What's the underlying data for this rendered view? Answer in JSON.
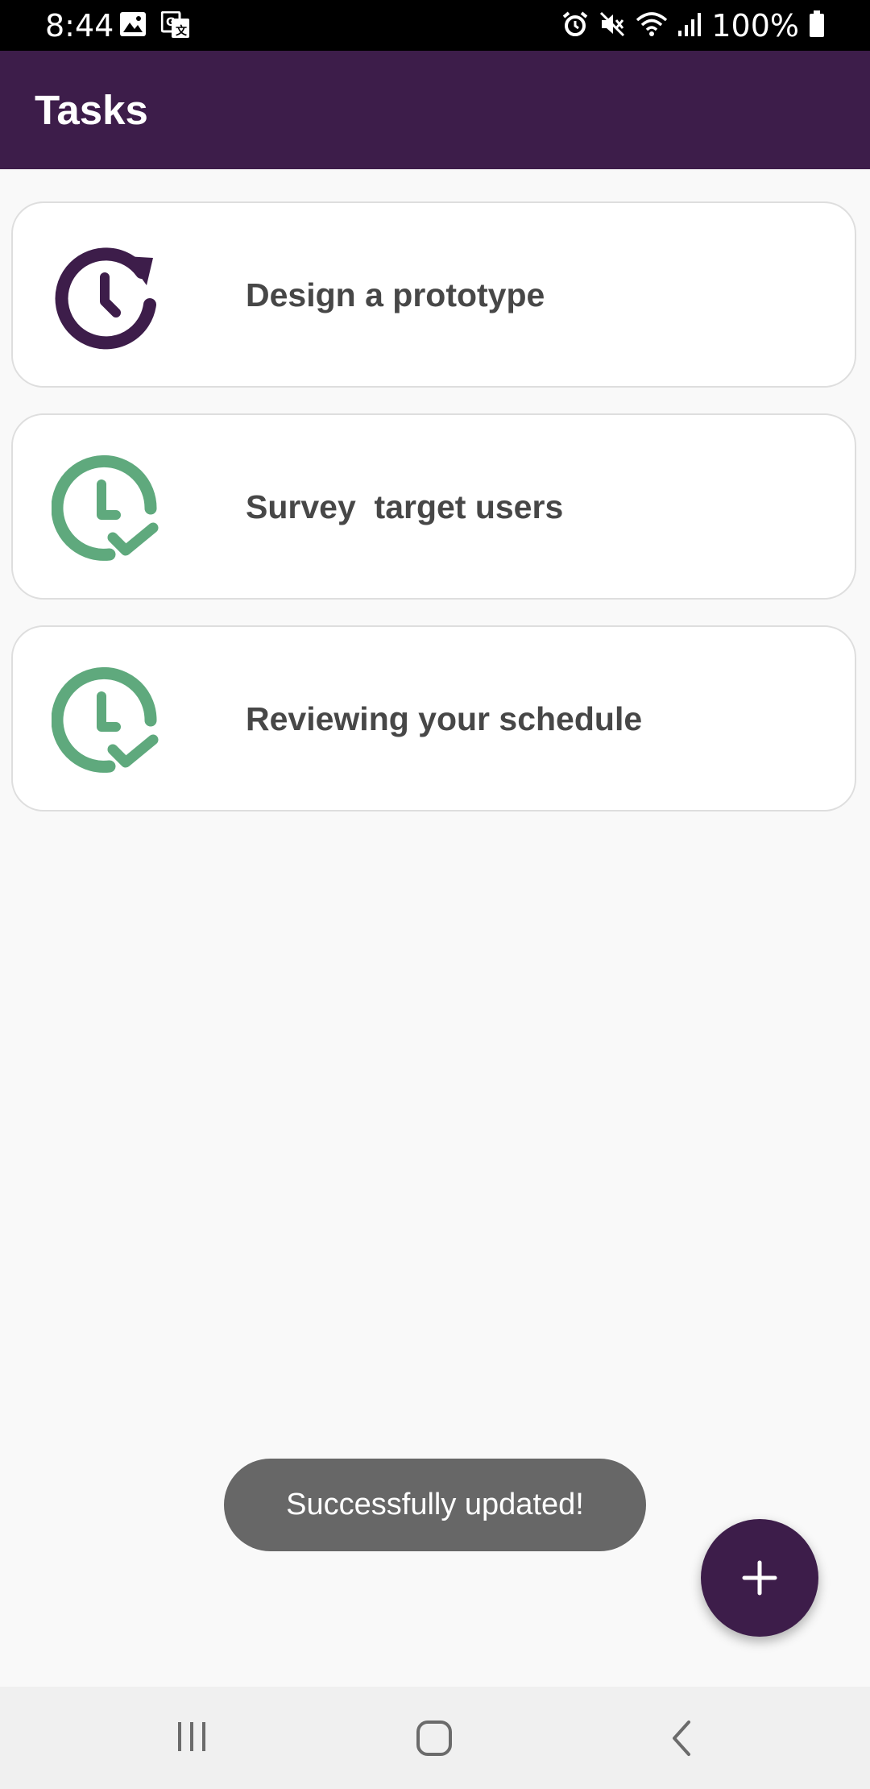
{
  "status_bar": {
    "time": "8:44",
    "battery": "100%",
    "left_icons": [
      "image-icon",
      "translate-icon"
    ],
    "right_icons": [
      "alarm-icon",
      "mute-icon",
      "wifi-icon",
      "signal-icon",
      "battery-icon"
    ]
  },
  "app_bar": {
    "title": "Tasks",
    "color": "#3d1d4a"
  },
  "tasks": [
    {
      "label": "Design a prototype",
      "status_icon": "clock-refresh-icon",
      "icon_color": "#3d1d4a"
    },
    {
      "label": "Survey  target users",
      "status_icon": "clock-check-icon",
      "icon_color": "#5fa97d"
    },
    {
      "label": "Reviewing your schedule",
      "status_icon": "clock-check-icon",
      "icon_color": "#5fa97d"
    }
  ],
  "toast": {
    "message": "Successfully updated!"
  },
  "fab": {
    "icon": "plus-icon",
    "color": "#3d1d4a"
  },
  "nav_bar": {
    "buttons": [
      "recent-apps-icon",
      "home-icon",
      "back-icon"
    ]
  }
}
